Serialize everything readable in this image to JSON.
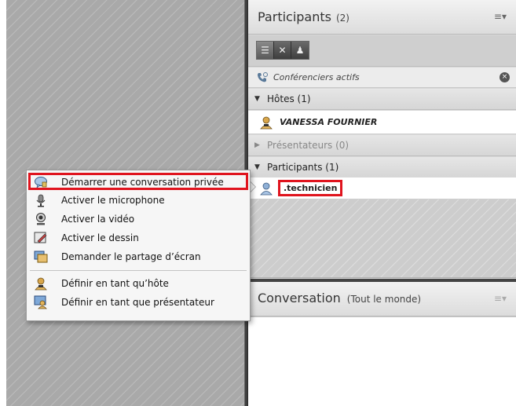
{
  "participants_pod": {
    "title": "Participants",
    "count": "(2)",
    "menu_glyph": "≡▾",
    "view_buttons": [
      {
        "icon": "list-view-icon",
        "glyph": "☰"
      },
      {
        "icon": "grid-view-icon",
        "glyph": "✕"
      },
      {
        "icon": "attendee-view-icon",
        "glyph": "♟"
      }
    ],
    "active_speakers": {
      "icon": "phone-icon",
      "label": "Conférenciers actifs",
      "close_glyph": "×"
    },
    "groups": [
      {
        "label": "Hôtes (1)",
        "expanded": true,
        "tri": "▼"
      },
      {
        "label": "Présentateurs (0)",
        "expanded": false,
        "tri": "▶"
      },
      {
        "label": "Participants (1)",
        "expanded": true,
        "tri": "▼"
      }
    ],
    "hosts": [
      {
        "name": "VANESSA FOURNIER",
        "icon": "host-user-icon"
      }
    ],
    "participants": [
      {
        "name": ".technicien",
        "icon": "participant-user-icon"
      }
    ]
  },
  "chat_pod": {
    "title": "Conversation",
    "audience": "(Tout le monde)",
    "menu_glyph": "≡▾"
  },
  "context_menu": {
    "items": [
      {
        "label": "Démarrer une conversation privée",
        "icon": "private-chat-icon"
      },
      {
        "label": "Activer le microphone",
        "icon": "microphone-icon"
      },
      {
        "label": "Activer la vidéo",
        "icon": "webcam-icon"
      },
      {
        "label": "Activer le dessin",
        "icon": "drawing-icon"
      },
      {
        "label": "Demander le partage d’écran",
        "icon": "screen-share-icon"
      },
      {
        "label": "Définir en tant qu’hôte",
        "icon": "make-host-icon"
      },
      {
        "label": "Définir en tant que présentateur",
        "icon": "make-presenter-icon"
      }
    ]
  },
  "colors": {
    "highlight": "#e0141e"
  }
}
